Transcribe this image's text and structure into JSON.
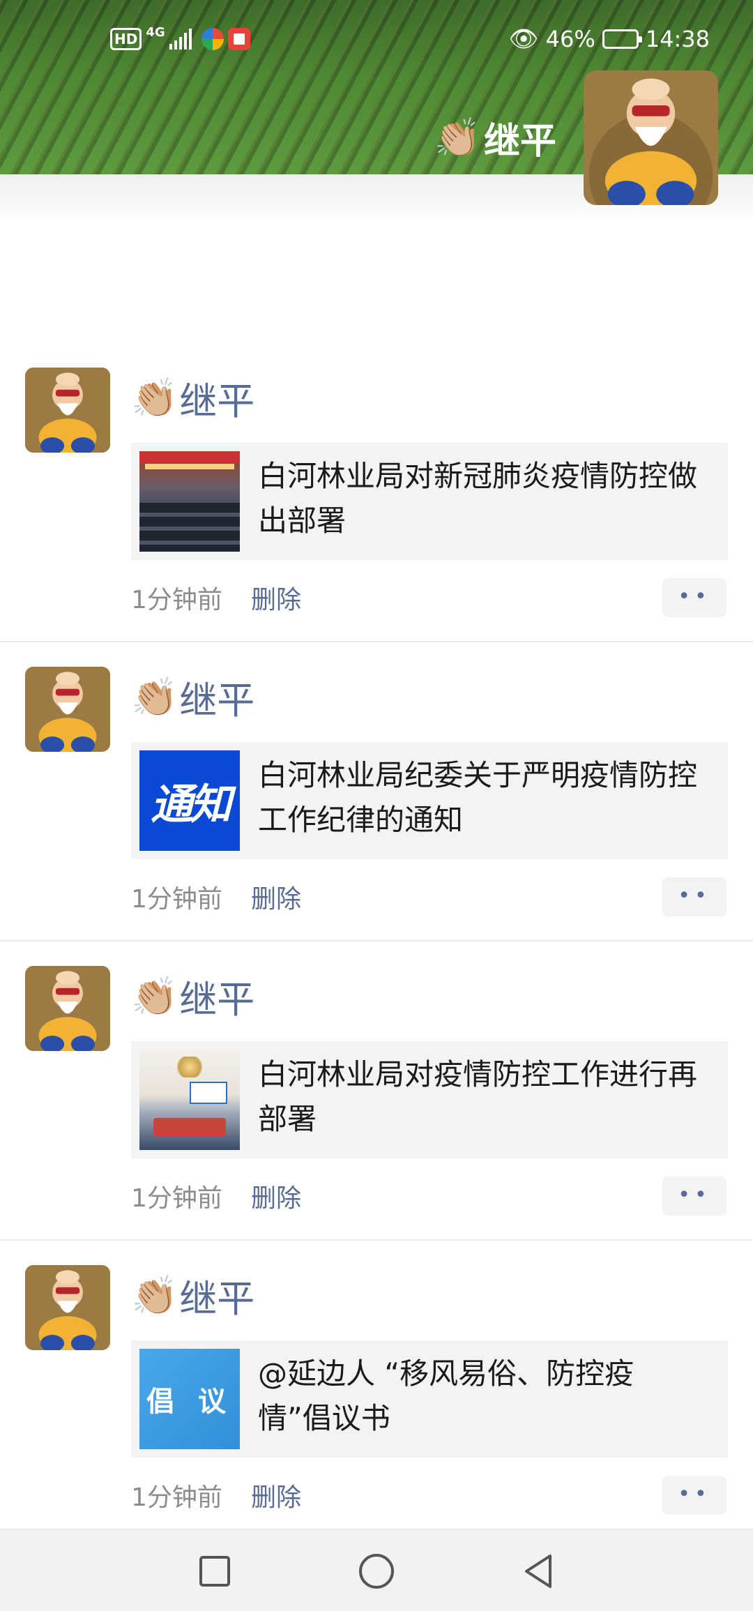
{
  "status_bar": {
    "hd_label": "HD",
    "network_label": "4G",
    "battery_percent": "46%",
    "battery_level": 0.46,
    "time": "14:38"
  },
  "profile": {
    "name": "继平",
    "name_emoji": "👏🏼"
  },
  "posts": [
    {
      "author": "继平",
      "author_emoji": "👏🏼",
      "link_title": "白河林业局对新冠肺炎疫情防控做出部署",
      "thumb_kind": "meeting-photo",
      "time": "1分钟前",
      "delete_label": "删除",
      "more_label": "••"
    },
    {
      "author": "继平",
      "author_emoji": "👏🏼",
      "link_title": "白河林业局纪委关于严明疫情防控工作纪律的通知",
      "thumb_kind": "notice-graphic",
      "thumb_text": "通知",
      "time": "1分钟前",
      "delete_label": "删除",
      "more_label": "••"
    },
    {
      "author": "继平",
      "author_emoji": "👏🏼",
      "link_title": "白河林业局对疫情防控工作进行再部署",
      "thumb_kind": "meeting-photo",
      "time": "1分钟前",
      "delete_label": "删除",
      "more_label": "••"
    },
    {
      "author": "继平",
      "author_emoji": "👏🏼",
      "link_title": "@延边人 “移风易俗、防控疫情”倡议书",
      "thumb_kind": "proposal-graphic",
      "thumb_text": "倡 议",
      "time": "1分钟前",
      "delete_label": "删除",
      "more_label": "••"
    }
  ],
  "nav": {
    "icons": [
      "recent-apps-icon",
      "home-icon",
      "back-icon"
    ]
  },
  "colors": {
    "link_blue": "#576b95",
    "card_bg": "#f3f3f5",
    "notice_blue": "#0a49d4",
    "proposal_blue": "#3a9ce2"
  }
}
